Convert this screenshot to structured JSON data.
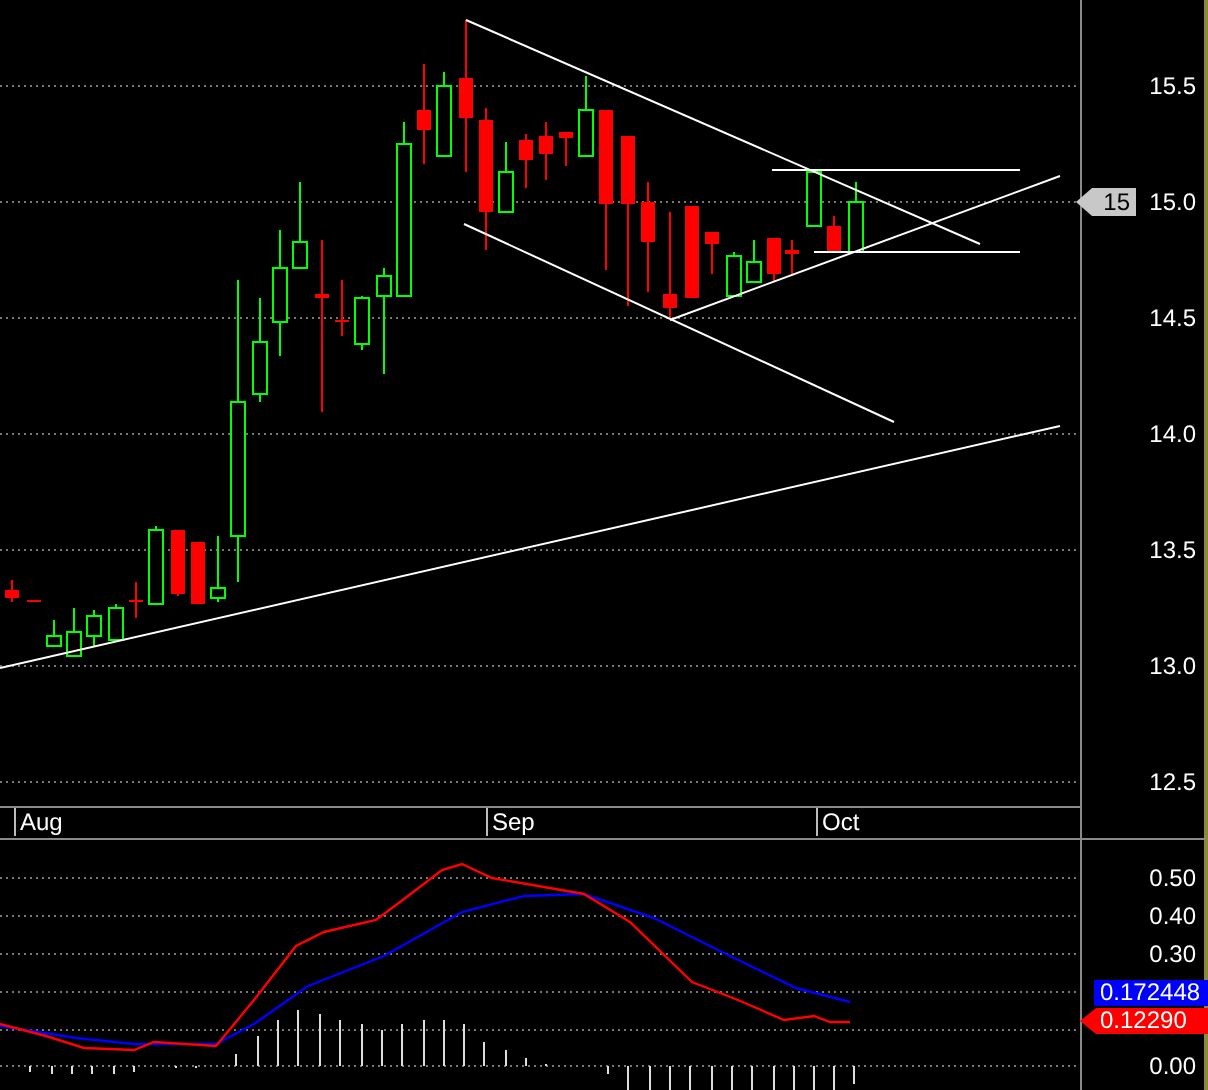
{
  "price_pane": {
    "axis_labels": [
      "15.5",
      "15.0",
      "14.5",
      "14.0",
      "13.5",
      "13.0",
      "12.5"
    ],
    "last_price_label": "15"
  },
  "date_axis": [
    "Aug",
    "Sep",
    "Oct"
  ],
  "indicator_pane": {
    "axis_labels": [
      "0.50",
      "0.40",
      "0.30",
      "0.00"
    ],
    "readings": [
      {
        "text": "0.172448",
        "color": "#0000ff",
        "pointer": false
      },
      {
        "text": "0.12290",
        "color": "#ff0000",
        "pointer": true
      }
    ]
  }
}
